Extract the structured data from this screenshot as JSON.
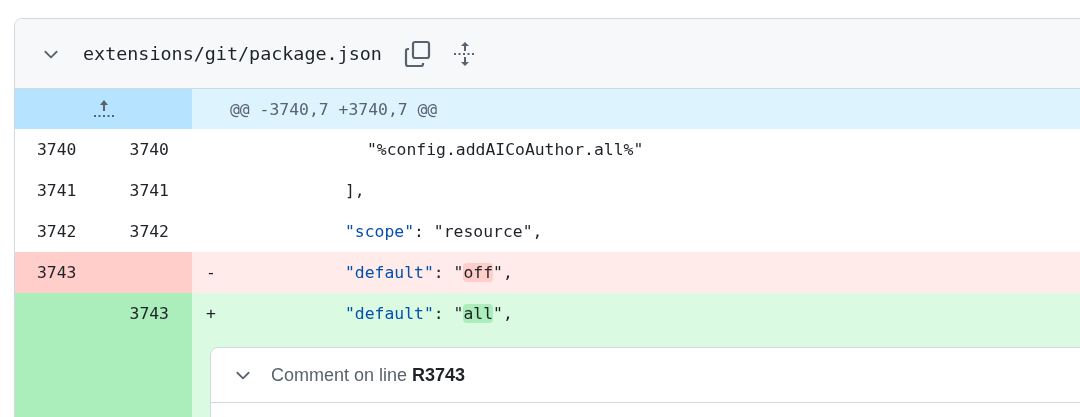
{
  "file": {
    "expanded": true,
    "path": "extensions/git/package.json"
  },
  "hunk": {
    "header": "@@ -3740,7 +3740,7 @@"
  },
  "lines": [
    {
      "kind": "context",
      "old": "3740",
      "new": "3740",
      "code": [
        {
          "kind": "array-item",
          "text": "\"%config.addAICoAuthor.all%\""
        }
      ]
    },
    {
      "kind": "context",
      "old": "3741",
      "new": "3741",
      "code": [
        {
          "kind": "plain",
          "text": "],"
        }
      ]
    },
    {
      "kind": "context",
      "old": "3742",
      "new": "3742",
      "code": [
        {
          "kind": "key",
          "text": "\"scope\""
        },
        {
          "kind": "plain",
          "text": ": \"resource\","
        }
      ]
    },
    {
      "kind": "deletion",
      "old": "3743",
      "sign": "-",
      "code": [
        {
          "kind": "key",
          "text": "\"default\""
        },
        {
          "kind": "plain",
          "text": ": \""
        },
        {
          "kind": "changed",
          "text": "off"
        },
        {
          "kind": "plain",
          "text": "\","
        }
      ]
    },
    {
      "kind": "addition",
      "new": "3743",
      "sign": "+",
      "code": [
        {
          "kind": "key",
          "text": "\"default\""
        },
        {
          "kind": "plain",
          "text": ": \""
        },
        {
          "kind": "changed",
          "text": "all"
        },
        {
          "kind": "plain",
          "text": "\","
        }
      ]
    }
  ],
  "comment": {
    "expanded": true,
    "title": "Comment on line **R3743**"
  }
}
